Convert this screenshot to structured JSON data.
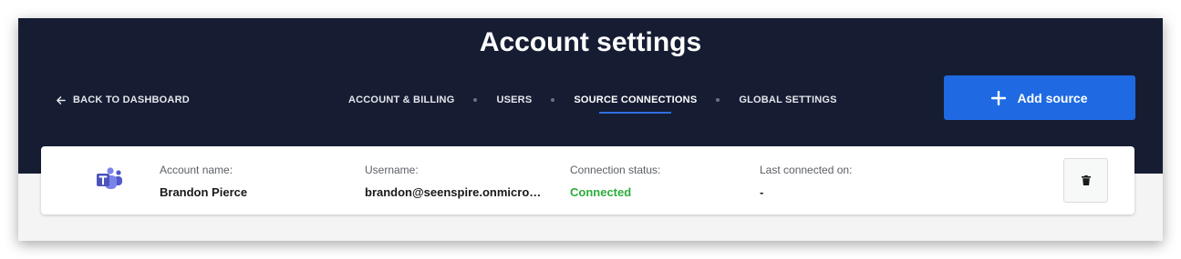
{
  "page": {
    "title": "Account settings",
    "back_label": "BACK TO DASHBOARD"
  },
  "nav": {
    "tabs": [
      {
        "label": "ACCOUNT & BILLING",
        "active": false
      },
      {
        "label": "USERS",
        "active": false
      },
      {
        "label": "SOURCE CONNECTIONS",
        "active": true
      },
      {
        "label": "GLOBAL SETTINGS",
        "active": false
      }
    ]
  },
  "actions": {
    "add_source_label": "Add source"
  },
  "connection": {
    "source_icon": "microsoft-teams-icon",
    "account_name_label": "Account name:",
    "account_name": "Brandon Pierce",
    "username_label": "Username:",
    "username": "brandon@seenspire.onmicro…",
    "status_label": "Connection status:",
    "status": "Connected",
    "last_connected_label": "Last connected on:",
    "last_connected": "-"
  },
  "colors": {
    "header_bg": "#161d33",
    "accent": "#1f6ae3",
    "status_connected": "#2cad3a",
    "teams_purple": "#5059c9"
  }
}
